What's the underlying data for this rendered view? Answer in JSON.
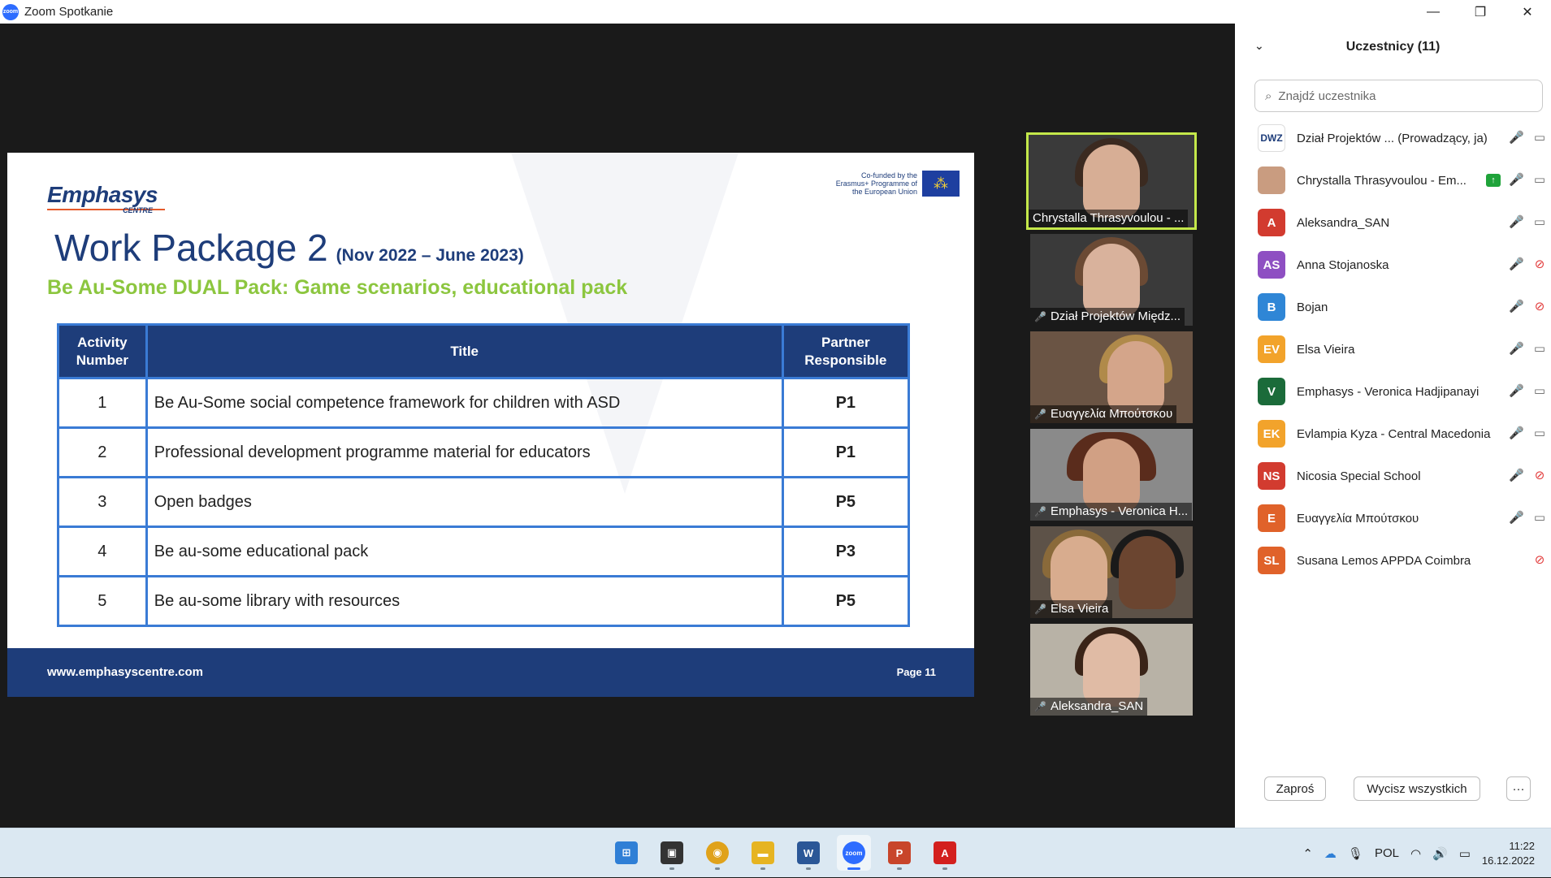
{
  "window": {
    "title": "Zoom Spotkanie",
    "app_logo_text": "zoom"
  },
  "slide": {
    "brand_name": "Emphasys",
    "brand_sub": "CENTRE",
    "eu_text": "Co-funded by the Erasmus+ Programme of the European Union",
    "title": "Work Package 2",
    "date": "(Nov 2022 – June 2023)",
    "subtitle": "Be Au-Some DUAL Pack: Game scenarios, educational pack",
    "table": {
      "headers": [
        "Activity Number",
        "Title",
        "Partner Responsible"
      ],
      "rows": [
        {
          "num": "1",
          "title": "Be Au-Some social competence framework for children with ASD",
          "partner": "P1"
        },
        {
          "num": "2",
          "title": "Professional development programme material for educators",
          "partner": "P1"
        },
        {
          "num": "3",
          "title": "Open badges",
          "partner": "P5"
        },
        {
          "num": "4",
          "title": "Be au-some educational pack",
          "partner": "P3"
        },
        {
          "num": "5",
          "title": "Be au-some library with resources",
          "partner": "P5"
        }
      ]
    },
    "footer_url": "www.emphasyscentre.com",
    "page": "Page 11"
  },
  "gallery": [
    {
      "name": "Chrystalla Thrasyvoulou - ...",
      "muted": false,
      "active": true
    },
    {
      "name": "Dział Projektów Międz...",
      "muted": true
    },
    {
      "name": "Ευαγγελία Μπούτσκου",
      "muted": true
    },
    {
      "name": "Emphasys - Veronica H...",
      "muted": true
    },
    {
      "name": "Elsa Vieira",
      "muted": true
    },
    {
      "name": "Aleksandra_SAN",
      "muted": true
    }
  ],
  "participants": {
    "header": "Uczestnicy (11)",
    "search_placeholder": "Znajdź uczestnika",
    "list": [
      {
        "initials": "DWZ",
        "name": "Dział Projektów ...  (Prowadzący, ja)",
        "color": "#ffffff",
        "mic": "off",
        "cam": "on"
      },
      {
        "initials": "",
        "name": "Chrystalla Thrasyvoulou - Em...",
        "color": "#c99c80",
        "mic": "on",
        "cam": "on",
        "sharing": true
      },
      {
        "initials": "A",
        "name": "Aleksandra_SAN",
        "color": "#d23b2f",
        "mic": "off",
        "cam": "on"
      },
      {
        "initials": "AS",
        "name": "Anna Stojanoska",
        "color": "#8e4fc2",
        "mic": "off",
        "cam": "off"
      },
      {
        "initials": "B",
        "name": "Bojan",
        "color": "#2f86d6",
        "mic": "off",
        "cam": "off"
      },
      {
        "initials": "EV",
        "name": "Elsa Vieira",
        "color": "#f2a32b",
        "mic": "off",
        "cam": "on"
      },
      {
        "initials": "V",
        "name": "Emphasys - Veronica Hadjipanayi",
        "color": "#1b6b3a",
        "mic": "off",
        "cam": "on"
      },
      {
        "initials": "EK",
        "name": "Evlampia Kyza - Central Macedonia",
        "color": "#f2a32b",
        "mic": "off",
        "cam": "on"
      },
      {
        "initials": "NS",
        "name": "Nicosia Special School",
        "color": "#d23b2f",
        "mic": "off",
        "cam": "off"
      },
      {
        "initials": "E",
        "name": "Ευαγγελία Μπούτσκου",
        "color": "#e0622a",
        "mic": "off",
        "cam": "on"
      },
      {
        "initials": "SL",
        "name": "Susana Lemos APPDA Coimbra",
        "color": "#e0622a",
        "mic": "none",
        "cam": "off"
      }
    ],
    "invite_label": "Zaproś",
    "mute_all_label": "Wycisz wszystkich",
    "more_label": "···"
  },
  "taskbar": {
    "apps": [
      {
        "name": "windows-start",
        "color": "#2f7fd6",
        "glyph": "⊞"
      },
      {
        "name": "file-explorer-dark",
        "color": "#333333",
        "glyph": "▣"
      },
      {
        "name": "chrome",
        "color": "#e0a21b",
        "glyph": "◉"
      },
      {
        "name": "folder",
        "color": "#e6b422",
        "glyph": "▬"
      },
      {
        "name": "word",
        "color": "#2b5797",
        "glyph": "W"
      },
      {
        "name": "zoom",
        "color": "#2d6cff",
        "glyph": "zoom",
        "active": true
      },
      {
        "name": "powerpoint",
        "color": "#c8452a",
        "glyph": "P"
      },
      {
        "name": "acrobat",
        "color": "#d3201e",
        "glyph": "A"
      }
    ],
    "language": "POL",
    "time": "11:22",
    "date": "16.12.2022"
  }
}
